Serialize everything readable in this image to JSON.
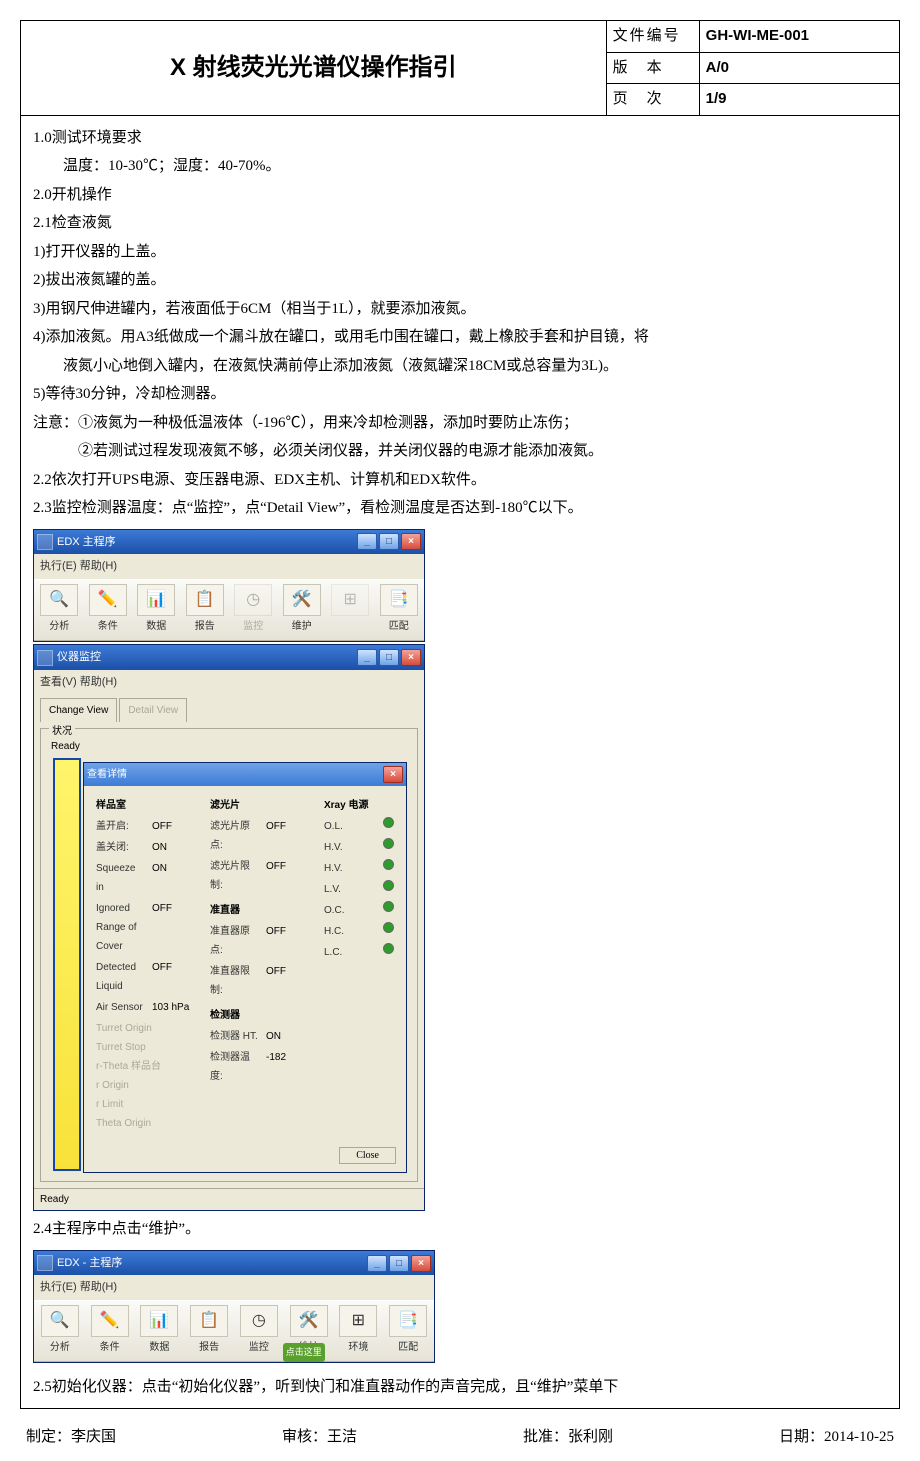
{
  "header": {
    "title": "X 射线荧光光谱仪操作指引",
    "doc_no_k": "文件编号",
    "doc_no_v": "GH-WI-ME-001",
    "ver_k": "版　本",
    "ver_v": "A/0",
    "page_k": "页　次",
    "page_v": "1/9"
  },
  "doc": {
    "s1": "1.0测试环境要求",
    "s1_1": "温度：10-30℃；湿度：40-70%。",
    "s2": "2.0开机操作",
    "s2_1": "2.1检查液氮",
    "l1": "1)打开仪器的上盖。",
    "l2": "2)拔出液氮罐的盖。",
    "l3": "3)用钢尺伸进罐内，若液面低于6CM（相当于1L），就要添加液氮。",
    "l4a": "4)添加液氮。用A3纸做成一个漏斗放在罐口，或用毛巾围在罐口，戴上橡胶手套和护目镜，将",
    "l4b": "液氮小心地倒入罐内，在液氮快满前停止添加液氮（液氮罐深18CM或总容量为3L)。",
    "l5": "5)等待30分钟，冷却检测器。",
    "n1": "注意：①液氮为一种极低温液体（-196℃），用来冷却检测器，添加时要防止冻伤；",
    "n2": "②若测试过程发现液氮不够，必须关闭仪器，并关闭仪器的电源才能添加液氮。",
    "s2_2": "2.2依次打开UPS电源、变压器电源、EDX主机、计算机和EDX软件。",
    "s2_3": "2.3监控检测器温度：点“监控”，点“Detail View”，看检测温度是否达到-180℃以下。",
    "s2_4": "2.4主程序中点击“维护”。",
    "s2_5": "2.5初始化仪器：点击“初始化仪器”，听到快门和准直器动作的声音完成，且“维护”菜单下"
  },
  "win1": {
    "title": "EDX 主程序",
    "menu": "执行(E)  帮助(H)",
    "btns": [
      "分析",
      "条件",
      "数据",
      "报告",
      "监控",
      "维护",
      "",
      "匹配"
    ]
  },
  "win2": {
    "title": "仪器监控",
    "menu": "查看(V)  帮助(H)",
    "tab1": "Change View",
    "tab2": "Detail View",
    "grp": "状况",
    "ready": "Ready"
  },
  "dlg": {
    "title": "查看详情",
    "c1": {
      "h": "样品室",
      "r": [
        [
          "盖开启:",
          "OFF"
        ],
        [
          "盖关闭:",
          "ON"
        ],
        [
          "Squeeze in",
          "ON"
        ],
        [
          "Ignored Range of Cover",
          "OFF"
        ],
        [
          "Detected Liquid",
          "OFF"
        ],
        [
          "Air Sensor",
          "103 hPa"
        ]
      ],
      "g": [
        "Turret Origin",
        "Turret Stop",
        "r-Theta 样品台",
        "r Origin",
        "r Limit",
        "Theta Origin"
      ]
    },
    "c2a": {
      "h": "滤光片",
      "r": [
        [
          "滤光片原点:",
          "OFF"
        ],
        [
          "滤光片限制:",
          "OFF"
        ]
      ]
    },
    "c2b": {
      "h": "准直器",
      "r": [
        [
          "准直器原点:",
          "OFF"
        ],
        [
          "准直器限制:",
          "OFF"
        ]
      ]
    },
    "c2c": {
      "h": "检测器",
      "r": [
        [
          "检测器 HT.",
          "ON"
        ],
        [
          "检测器温度:",
          "-182"
        ]
      ]
    },
    "c3": {
      "h": "Xray 电源",
      "r": [
        "O.L.",
        "H.V.",
        "H.V.",
        "L.V.",
        "O.C.",
        "H.C.",
        "L.C."
      ]
    },
    "close": "Close",
    "status": "Ready"
  },
  "win3": {
    "title": "EDX - 主程序",
    "menu": "执行(E)  帮助(H)",
    "btns": [
      "分析",
      "条件",
      "数据",
      "报告",
      "监控",
      "维护",
      "环境",
      "匹配"
    ],
    "tip": "点击这里"
  },
  "footer": {
    "a": "制定：李庆国",
    "b": "审核：王洁",
    "c": "批准：张利刚",
    "d": "日期：2014-10-25"
  }
}
